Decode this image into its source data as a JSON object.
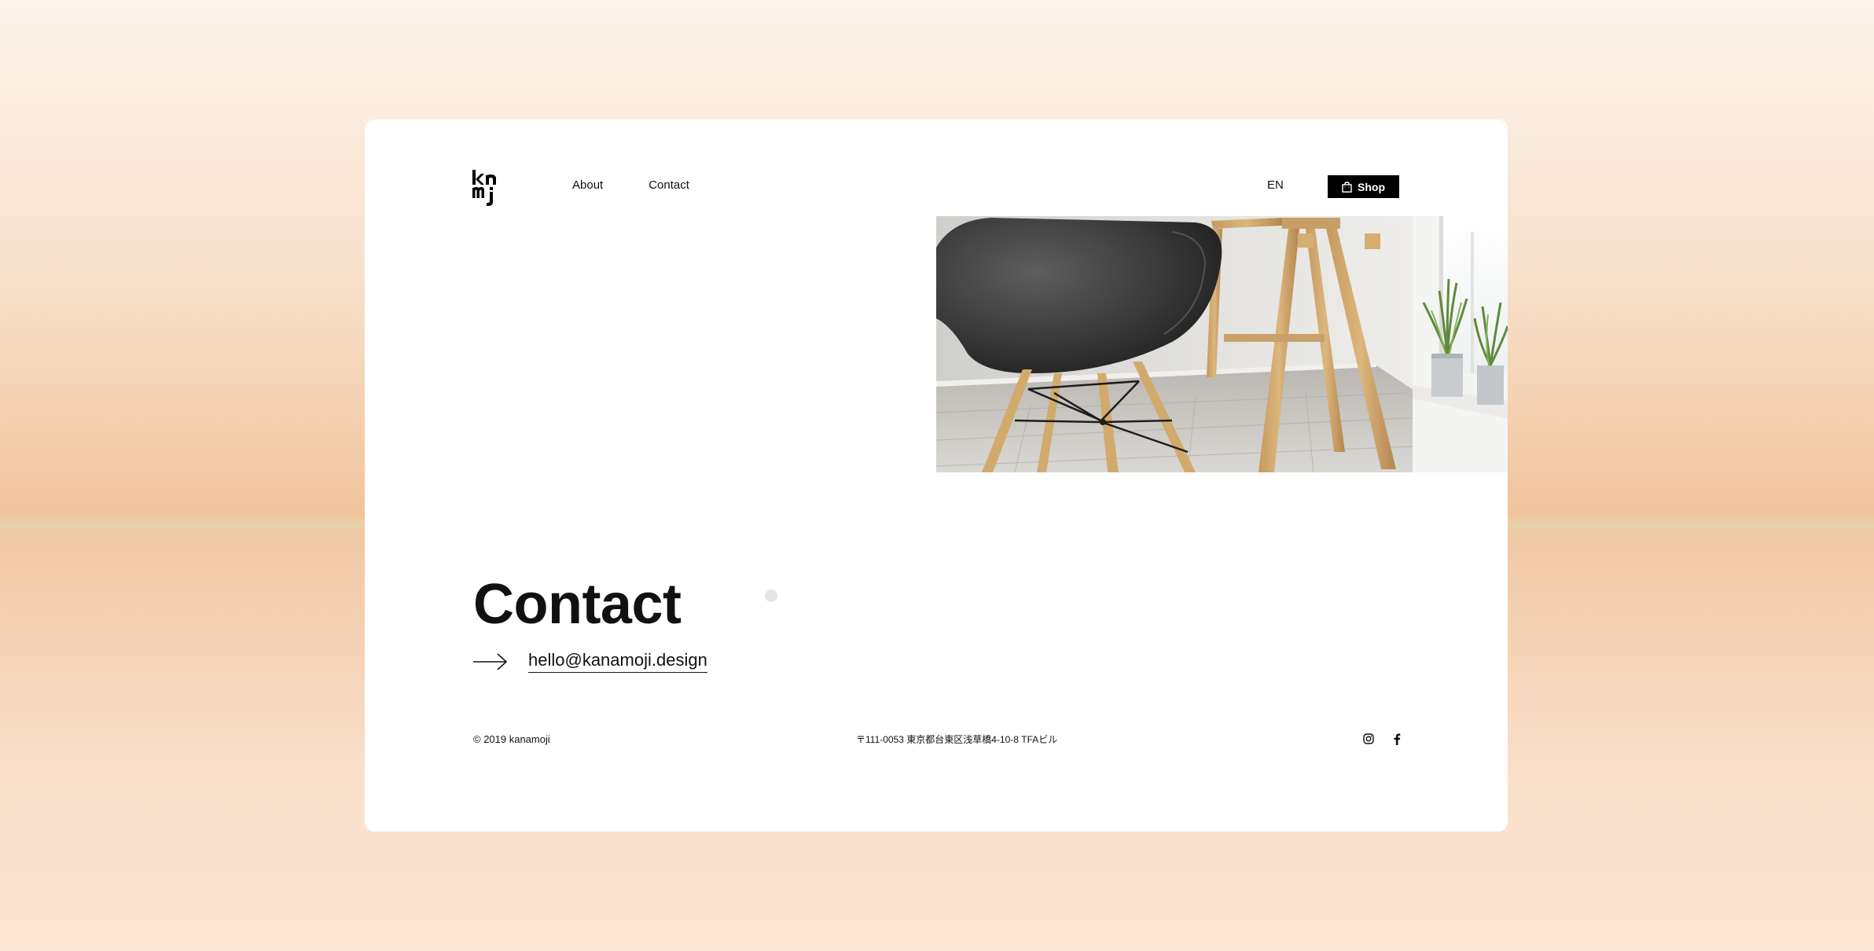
{
  "header": {
    "logo_alt": "kanamoji",
    "nav": [
      {
        "label": "About"
      },
      {
        "label": "Contact"
      }
    ],
    "language": "EN",
    "shop_label": "Shop",
    "shop_icon": "shopping-bag-icon"
  },
  "hero": {
    "image": "black-shell-chair-and-wooden-trestle-photo"
  },
  "main": {
    "title": "Contact",
    "arrow_icon": "arrow-right-icon",
    "email": "hello@kanamoji.design"
  },
  "footer": {
    "copyright": "© 2019 kanamoji",
    "address": "〒111-0053 東京都台東区浅草橋4-10-8 TFAビル",
    "social": [
      "instagram-icon",
      "facebook-icon"
    ]
  }
}
